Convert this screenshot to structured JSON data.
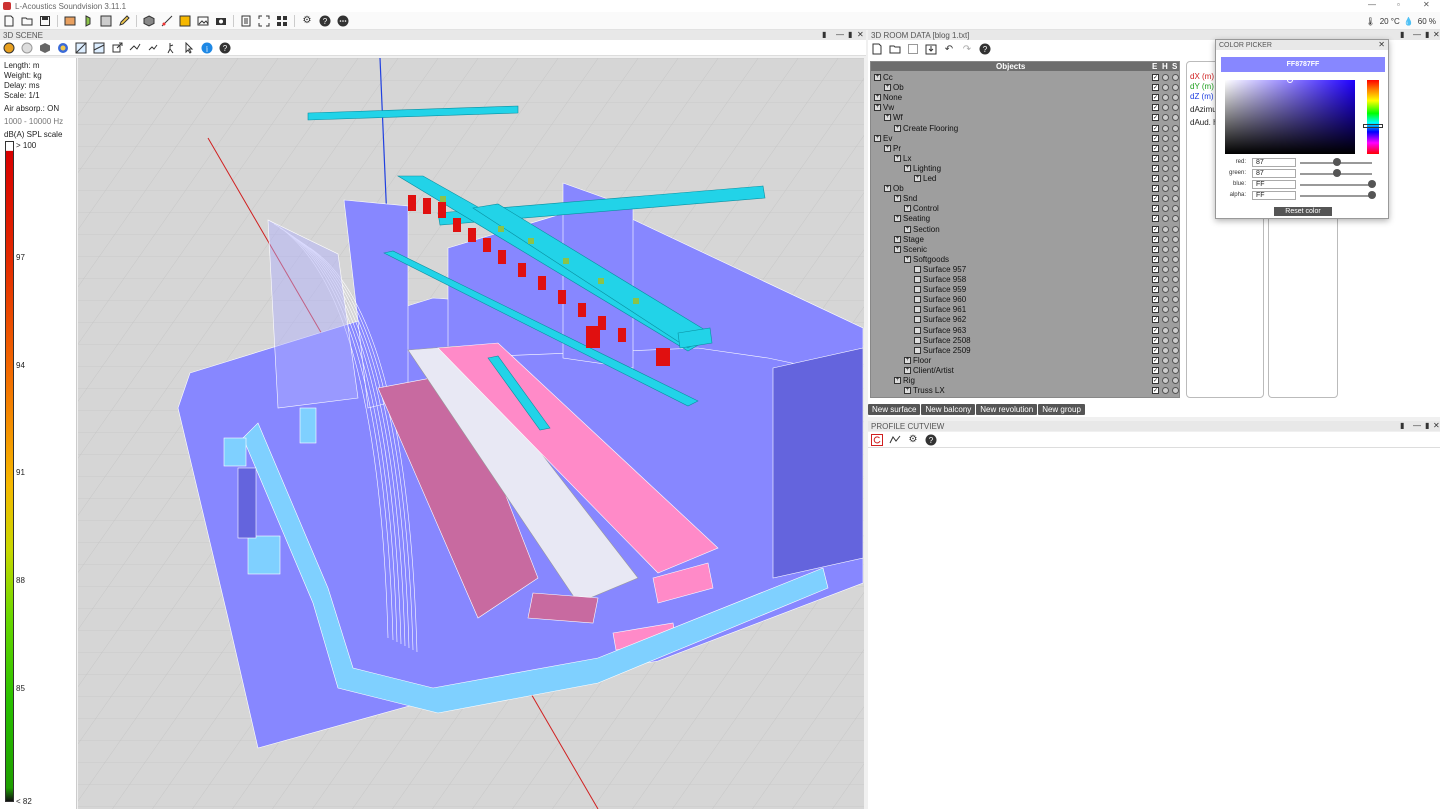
{
  "app": {
    "title": "L-Acoustics Soundvision 3.11.1"
  },
  "environment": {
    "temperature": "20 °C",
    "humidity": "60 %"
  },
  "panels": {
    "scene": {
      "title": "3D SCENE"
    },
    "room_data": {
      "title": "3D ROOM DATA [blog 1.txt]"
    },
    "profile": {
      "title": "PROFILE CUTVIEW"
    }
  },
  "scene_info": {
    "length": "Length: m",
    "weight": "Weight: kg",
    "delay": "Delay: ms",
    "scale": "Scale: 1/1",
    "air_absorp": "Air absorp.: ON",
    "freq_range": "1000 - 10000 Hz",
    "spl_label": "dB(A) SPL scale",
    "spl_ticks": [
      "> 100",
      "97",
      "94",
      "91",
      "88",
      "85",
      "< 82"
    ]
  },
  "tree": {
    "header": {
      "objects": "Objects",
      "e": "E",
      "h": "H",
      "s": "S"
    },
    "rows": [
      {
        "label": "Cc",
        "indent": 0
      },
      {
        "label": "Ob",
        "indent": 1
      },
      {
        "label": "None",
        "indent": 0
      },
      {
        "label": "Vw",
        "indent": 0
      },
      {
        "label": "Wf",
        "indent": 1
      },
      {
        "label": "Create Flooring",
        "indent": 2
      },
      {
        "label": "Ev",
        "indent": 0
      },
      {
        "label": "Pr",
        "indent": 1
      },
      {
        "label": "Lx",
        "indent": 2
      },
      {
        "label": "Lighting",
        "indent": 3
      },
      {
        "label": "Led",
        "indent": 4
      },
      {
        "label": "Ob",
        "indent": 1
      },
      {
        "label": "Snd",
        "indent": 2
      },
      {
        "label": "Control",
        "indent": 3
      },
      {
        "label": "Seating",
        "indent": 2
      },
      {
        "label": "Section",
        "indent": 3
      },
      {
        "label": "Stage",
        "indent": 2
      },
      {
        "label": "Scenic",
        "indent": 2
      },
      {
        "label": "Softgoods",
        "indent": 3
      },
      {
        "label": "Surface 957",
        "indent": 4
      },
      {
        "label": "Surface 958",
        "indent": 4
      },
      {
        "label": "Surface 959",
        "indent": 4
      },
      {
        "label": "Surface 960",
        "indent": 4
      },
      {
        "label": "Surface 961",
        "indent": 4
      },
      {
        "label": "Surface 962",
        "indent": 4
      },
      {
        "label": "Surface 963",
        "indent": 4
      },
      {
        "label": "Surface 2508",
        "indent": 4
      },
      {
        "label": "Surface 2509",
        "indent": 4
      },
      {
        "label": "Floor",
        "indent": 3
      },
      {
        "label": "Client/Artist",
        "indent": 3
      },
      {
        "label": "Rig",
        "indent": 2
      },
      {
        "label": "Truss LX",
        "indent": 3
      }
    ]
  },
  "properties": {
    "dx": "dX (m)",
    "dy": "dY (m)",
    "dz": "dZ (m)",
    "dazimuth": "dAzimu",
    "daud": "dAud. he"
  },
  "buttons": {
    "new_surface": "New surface",
    "new_balcony": "New balcony",
    "new_revolution": "New revolution",
    "new_group": "New group"
  },
  "color_picker": {
    "title": "COLOR PICKER",
    "hex": "FF8787FF",
    "red_label": "red:",
    "red": "87",
    "green_label": "green:",
    "green": "87",
    "blue_label": "blue:",
    "blue": "FF",
    "alpha_label": "alpha:",
    "alpha": "FF",
    "reset_label": "Reset color"
  },
  "colors": {
    "surface": "#8787ff",
    "truss": "#22d3e8",
    "speaker": "#e01010",
    "seating_pink": "#ff8ac8",
    "seating_dark": "#c86aa0",
    "barrier": "#7fd0ff"
  }
}
